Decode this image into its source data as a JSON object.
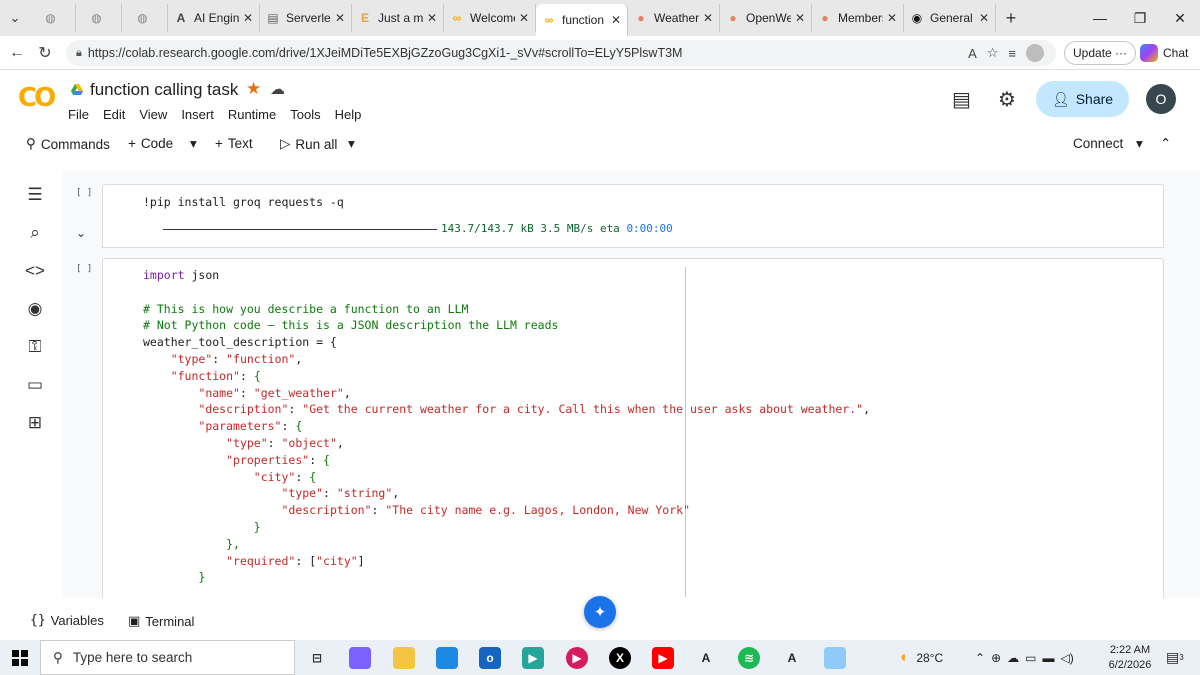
{
  "browser": {
    "tabs": [
      {
        "label": "",
        "favicon": "globe-icon"
      },
      {
        "label": "",
        "favicon": "globe-icon"
      },
      {
        "label": "",
        "favicon": "globe-icon"
      },
      {
        "label": "AI Engine",
        "favicon": "ai-engine-icon"
      },
      {
        "label": "Serverles",
        "favicon": "doc-icon"
      },
      {
        "label": "Just a mo",
        "favicon": "e-icon"
      },
      {
        "label": "Welcome",
        "favicon": "colab-icon"
      },
      {
        "label": "function",
        "favicon": "colab-icon",
        "active": true
      },
      {
        "label": "Weather",
        "favicon": "openweather-icon"
      },
      {
        "label": "OpenWe",
        "favicon": "openweather-icon"
      },
      {
        "label": "Members",
        "favicon": "openweather-icon"
      },
      {
        "label": "General",
        "favicon": "github-icon"
      }
    ],
    "url": "https://colab.research.google.com/drive/1XJeiMDiTe5EXBjGZzoGug3CgXi1-_sVv#scrollTo=ELyY5PlswT3M",
    "update_label": "Update",
    "chat_label": "Chat"
  },
  "colab": {
    "logo": "CO",
    "notebook_title": "function calling task",
    "menu": [
      "File",
      "Edit",
      "View",
      "Insert",
      "Runtime",
      "Tools",
      "Help"
    ],
    "share_label": "Share",
    "user_initial": "O",
    "toolbar": {
      "commands": "Commands",
      "code": "Code",
      "text": "Text",
      "run_all": "Run all",
      "connect": "Connect"
    },
    "cell_bracket": "[ ]"
  },
  "cells": {
    "cell1_code": "!pip install groq requests -q",
    "cell1_progress": "143.7/143.7 kB 3.5 MB/s eta",
    "cell1_eta": "0:00:00",
    "cell2_lines": [
      [
        {
          "t": "import",
          "c": "kw"
        },
        {
          "t": " json",
          "c": ""
        }
      ],
      [],
      [
        {
          "t": "# This is how you describe a function to an LLM",
          "c": "cm"
        }
      ],
      [
        {
          "t": "# Not Python code — this is a JSON description the LLM reads",
          "c": "cm"
        }
      ],
      [
        {
          "t": "weather_tool_description = {",
          "c": ""
        }
      ],
      [
        {
          "t": "    ",
          "c": ""
        },
        {
          "t": "\"type\"",
          "c": "str"
        },
        {
          "t": ": ",
          "c": ""
        },
        {
          "t": "\"function\"",
          "c": "str"
        },
        {
          "t": ",",
          "c": ""
        }
      ],
      [
        {
          "t": "    ",
          "c": ""
        },
        {
          "t": "\"function\"",
          "c": "str"
        },
        {
          "t": ": ",
          "c": ""
        },
        {
          "t": "{",
          "c": "br"
        }
      ],
      [
        {
          "t": "        ",
          "c": ""
        },
        {
          "t": "\"name\"",
          "c": "str"
        },
        {
          "t": ": ",
          "c": ""
        },
        {
          "t": "\"get_weather\"",
          "c": "str"
        },
        {
          "t": ",",
          "c": ""
        }
      ],
      [
        {
          "t": "        ",
          "c": ""
        },
        {
          "t": "\"description\"",
          "c": "str"
        },
        {
          "t": ": ",
          "c": ""
        },
        {
          "t": "\"Get the current weather for a city. Call this when the user asks about weather.\"",
          "c": "str"
        },
        {
          "t": ",",
          "c": ""
        }
      ],
      [
        {
          "t": "        ",
          "c": ""
        },
        {
          "t": "\"parameters\"",
          "c": "str"
        },
        {
          "t": ": ",
          "c": ""
        },
        {
          "t": "{",
          "c": "br"
        }
      ],
      [
        {
          "t": "            ",
          "c": ""
        },
        {
          "t": "\"type\"",
          "c": "str"
        },
        {
          "t": ": ",
          "c": ""
        },
        {
          "t": "\"object\"",
          "c": "str"
        },
        {
          "t": ",",
          "c": ""
        }
      ],
      [
        {
          "t": "            ",
          "c": ""
        },
        {
          "t": "\"properties\"",
          "c": "str"
        },
        {
          "t": ": ",
          "c": ""
        },
        {
          "t": "{",
          "c": "br"
        }
      ],
      [
        {
          "t": "                ",
          "c": ""
        },
        {
          "t": "\"city\"",
          "c": "str"
        },
        {
          "t": ": ",
          "c": ""
        },
        {
          "t": "{",
          "c": "br"
        }
      ],
      [
        {
          "t": "                    ",
          "c": ""
        },
        {
          "t": "\"type\"",
          "c": "str"
        },
        {
          "t": ": ",
          "c": ""
        },
        {
          "t": "\"string\"",
          "c": "str"
        },
        {
          "t": ",",
          "c": ""
        }
      ],
      [
        {
          "t": "                    ",
          "c": ""
        },
        {
          "t": "\"description\"",
          "c": "str"
        },
        {
          "t": ": ",
          "c": ""
        },
        {
          "t": "\"The city name e.g. Lagos, London, New York\"",
          "c": "str"
        }
      ],
      [
        {
          "t": "                ",
          "c": ""
        },
        {
          "t": "}",
          "c": "br"
        }
      ],
      [
        {
          "t": "            ",
          "c": ""
        },
        {
          "t": "},",
          "c": "br"
        }
      ],
      [
        {
          "t": "            ",
          "c": ""
        },
        {
          "t": "\"required\"",
          "c": "str"
        },
        {
          "t": ": [",
          "c": ""
        },
        {
          "t": "\"city\"",
          "c": "str"
        },
        {
          "t": "]",
          "c": ""
        }
      ],
      [
        {
          "t": "        ",
          "c": ""
        },
        {
          "t": "}",
          "c": "br"
        }
      ]
    ]
  },
  "bottom": {
    "variables": "Variables",
    "terminal": "Terminal"
  },
  "taskbar": {
    "search_placeholder": "Type here to search",
    "temperature": "28°C",
    "time": "2:22 AM",
    "date": "6/2/2026",
    "notification_count": "3"
  }
}
